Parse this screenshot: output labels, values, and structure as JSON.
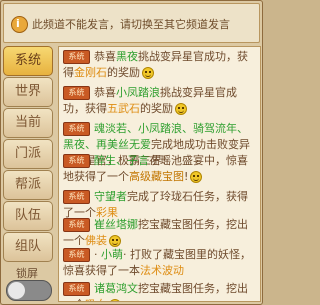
{
  "notice": {
    "text": "此频道不能发言，请切换至其它频道发言"
  },
  "tabs": [
    {
      "label": "系统",
      "active": true
    },
    {
      "label": "世界",
      "active": false
    },
    {
      "label": "当前",
      "active": false
    },
    {
      "label": "门派",
      "active": false
    },
    {
      "label": "帮派",
      "active": false
    },
    {
      "label": "队伍",
      "active": false
    },
    {
      "label": "组队",
      "active": false
    }
  ],
  "lock_screen": {
    "label": "锁屏"
  },
  "message_tag": "系统",
  "messages": [
    {
      "tag": "系统",
      "pre": "恭喜",
      "name": "黑夜",
      "mid": "挑战变异星官成功，获得",
      "item": "金刚石",
      "post": "的奖励"
    },
    {
      "tag": "系统",
      "pre": "恭喜",
      "name": "小凤踏浪",
      "mid": "挑战变异星官成功，获得",
      "item": "五武石",
      "post": "的奖励"
    },
    {
      "tag": "系统",
      "pre": "",
      "name": "魂淡若、小凤踏浪、骑驾流年、黑夜、再美丝无爱",
      "mid": "完成地成功击败变异北曜星官，极霸三界!",
      "item": "",
      "post": ""
    },
    {
      "tag": "系统",
      "pre": "",
      "name": "醉生、子言",
      "mid": "在瑶池盛宴中，惊喜地获得了一个",
      "item": "高级藏宝图",
      "post": "!"
    },
    {
      "tag": "系统",
      "pre": "",
      "name": "守望者",
      "mid": "完成了玲珑石任务，获得了一个",
      "item": "彩果",
      "post": ""
    },
    {
      "tag": "系统",
      "pre": "",
      "name": "崔丝塔娜",
      "mid": "挖宝藏宝图任务，挖出一个",
      "item": "佛装",
      "post": ""
    },
    {
      "tag": "系统",
      "pre": "· ",
      "name": "小萌",
      "mid": "· 打败了藏宝图里的妖怪，惊喜获得了一本",
      "item": "法术波动",
      "post": ""
    },
    {
      "tag": "系统",
      "pre": "",
      "name": "诸葛鸿文",
      "mid": "挖宝藏宝图任务，挖出一个",
      "item": "吸血",
      "post": ""
    }
  ]
}
